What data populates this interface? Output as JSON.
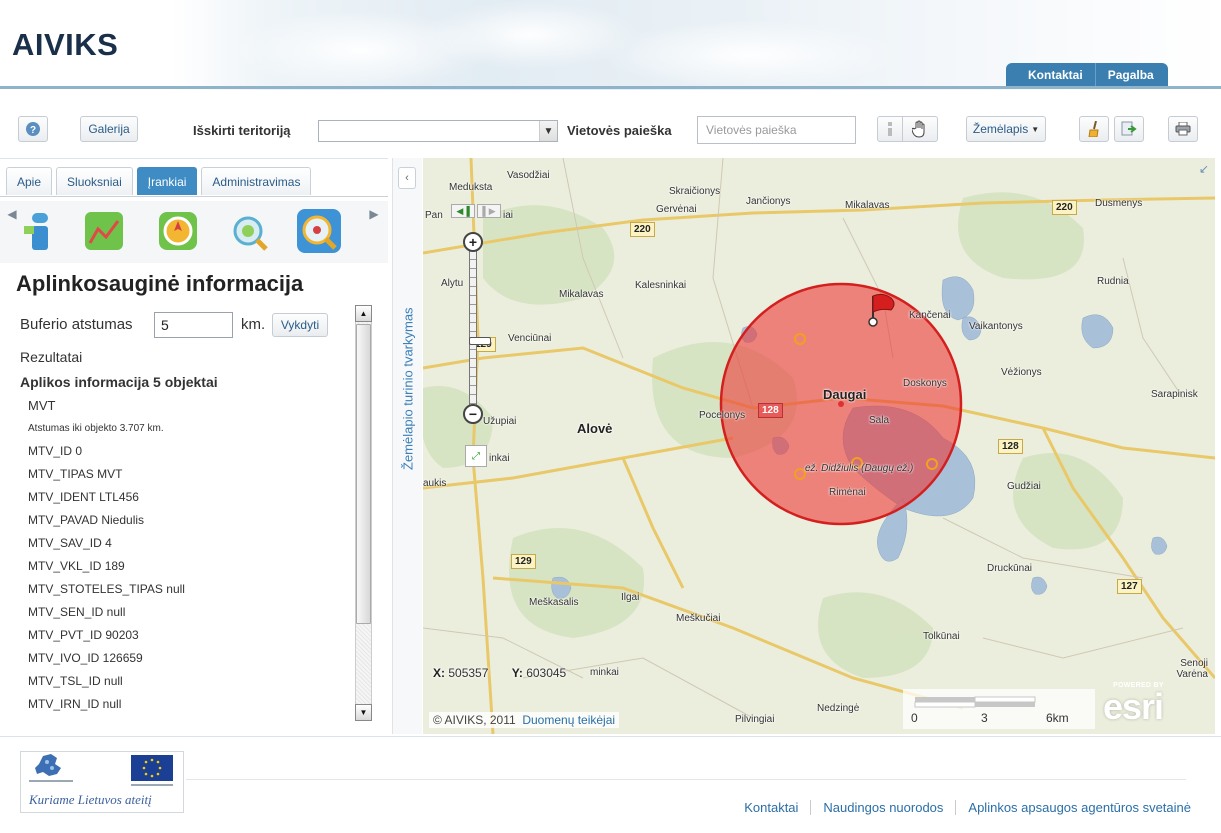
{
  "header": {
    "app_title": "AIVIKS",
    "tabs": [
      {
        "label": "Kontaktai"
      },
      {
        "label": "Pagalba"
      }
    ]
  },
  "toolbar": {
    "help_icon": "help-icon",
    "gallery_label": "Galerija",
    "territory_label": "Išskirti teritoriją",
    "territory_value": "",
    "search_label": "Vietovės paieška",
    "search_placeholder": "Vietovės paieška",
    "map_type_label": "Žemėlapis",
    "icons": [
      "info-icon",
      "pan-hand-icon",
      "clear-broom-icon",
      "export-icon",
      "print-icon"
    ]
  },
  "left_panel": {
    "tabs": [
      {
        "label": "Apie",
        "active": false
      },
      {
        "label": "Sluoksniai",
        "active": false
      },
      {
        "label": "Įrankiai",
        "active": true
      },
      {
        "label": "Administravimas",
        "active": false
      }
    ],
    "tool_icons": [
      "info-tool-icon",
      "chart-tool-icon",
      "compass-tool-icon",
      "search-area-tool-icon",
      "buffer-search-tool-icon"
    ],
    "title": "Aplinkosauginė informacija",
    "buffer": {
      "label": "Buferio atstumas",
      "value": "5",
      "unit": "km.",
      "run_label": "Vykdyti"
    },
    "results_label": "Rezultatai",
    "results_header": "Aplikos informacija 5 objektai",
    "results": [
      "MVT",
      "Atstumas iki objekto 3.707 km.",
      "MTV_ID 0",
      "MTV_TIPAS MVT",
      "MTV_IDENT LTL456",
      "MTV_PAVAD Niedulis",
      "MTV_SAV_ID 4",
      "MTV_VKL_ID 189",
      "MTV_STOTELES_TIPAS null",
      "MTV_SEN_ID null",
      "MTV_PVT_ID 90203",
      "MTV_IVO_ID 126659",
      "MTV_TSL_ID null",
      "MTV_IRN_ID null"
    ]
  },
  "strip": {
    "label": "Žemėlapio turinio tvarkymas"
  },
  "map": {
    "places": [
      "Vasodžiai",
      "Meduksta",
      "Skraičionys",
      "Jančionys",
      "Mikalavas",
      "Dusmenys",
      "Gervėnai",
      "Alytu",
      "Kalesninkai",
      "Mikalavas",
      "Rudnia",
      "Kančenai",
      "Vaikantonys",
      "Venciūnai",
      "Daugai",
      "Doskonys",
      "Vėžionys",
      "Pocelonys",
      "Sala",
      "Sarapinisk",
      "Alovė",
      "Užupiai",
      "inkai",
      "ež. Didžiulis (Daugų ež.)",
      "aukis",
      "Rimėnai",
      "Gudžiai",
      "Druckūnai",
      "Meškasalis",
      "Ilgai",
      "Meškučiai",
      "Tolkūnai",
      "Senoji Varėna",
      "minkai",
      "Pilvingiai",
      "Nedzingė",
      "Pan",
      "iai"
    ],
    "road_numbers": [
      "220",
      "220",
      "129",
      "128",
      "128",
      "129",
      "127"
    ],
    "coord_x_label": "X:",
    "coord_x": "505357",
    "coord_y_label": "Y:",
    "coord_y": "603045",
    "attribution": "© AIVIKS, 2011",
    "attribution_link": "Duomenų teikėjai",
    "scale_labels": [
      "0",
      "3",
      "6km"
    ],
    "esri_powered": "POWERED BY",
    "esri_logo": "esri",
    "buffer_color": "#ee3333"
  },
  "footer": {
    "eu_caption": "Kuriame Lietuvos ateitį",
    "links": [
      "Kontaktai",
      "Naudingos nuorodos",
      "Aplinkos apsaugos agentūros svetainė"
    ]
  }
}
